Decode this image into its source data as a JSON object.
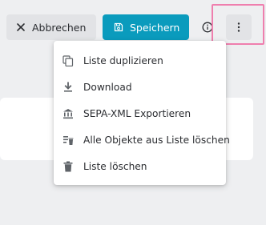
{
  "toolbar": {
    "cancel_label": "Abbrechen",
    "save_label": "Speichern",
    "cancel_icon": "close-icon",
    "save_icon": "floppy-disk-icon",
    "info_icon": "info-icon",
    "more_icon": "more-vertical-icon"
  },
  "menu": {
    "items": [
      {
        "label": "Liste duplizieren",
        "icon": "copy-icon"
      },
      {
        "label": "Download",
        "icon": "download-icon"
      },
      {
        "label": "SEPA-XML Exportieren",
        "icon": "bank-icon"
      },
      {
        "label": "Alle Objekte aus Liste löschen",
        "icon": "clear-list-icon"
      },
      {
        "label": "Liste löschen",
        "icon": "trash-icon"
      }
    ]
  },
  "colors": {
    "primary": "#0a9bbd",
    "page_background": "#eeeff1",
    "secondary_button": "#e2e3e6",
    "focus_outline": "#ef7fae"
  }
}
